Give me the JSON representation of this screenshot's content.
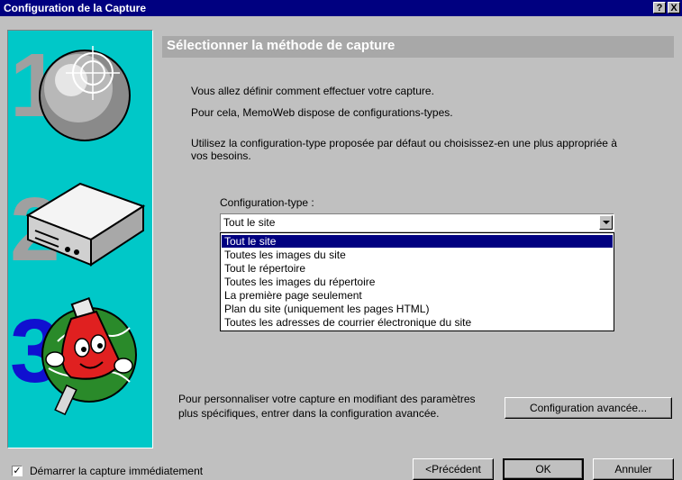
{
  "window": {
    "title": "Configuration de la Capture",
    "help": "?",
    "close": "X"
  },
  "panel": {
    "header": "Sélectionner la méthode de capture"
  },
  "intro": {
    "line1": "Vous allez définir comment effectuer votre capture.",
    "line2": "Pour cela, MemoWeb dispose de configurations-types.",
    "line3a": "Utilisez la configuration-type proposée par défaut ou choisissez-en une plus appropriée à",
    "line3b": "vos besoins."
  },
  "config": {
    "label": "Configuration-type :",
    "value": "Tout le site",
    "options": [
      "Tout le site",
      "Toutes les images du site",
      "Tout le répertoire",
      "Toutes les images du répertoire",
      "La première page seulement",
      "Plan du site (uniquement les pages HTML)",
      "Toutes les adresses de courrier électronique du site"
    ]
  },
  "advanced": {
    "text1": "Pour personnaliser votre capture en modifiant des paramètres",
    "text2": "plus spécifiques, entrer dans la configuration avancée.",
    "button": "Configuration avancée..."
  },
  "footer": {
    "checkbox_label": "Démarrer la capture immédiatement",
    "checked": true,
    "prev": "<Précédent",
    "ok": "OK",
    "cancel": "Annuler"
  },
  "steps": [
    "1",
    "2",
    "3"
  ]
}
